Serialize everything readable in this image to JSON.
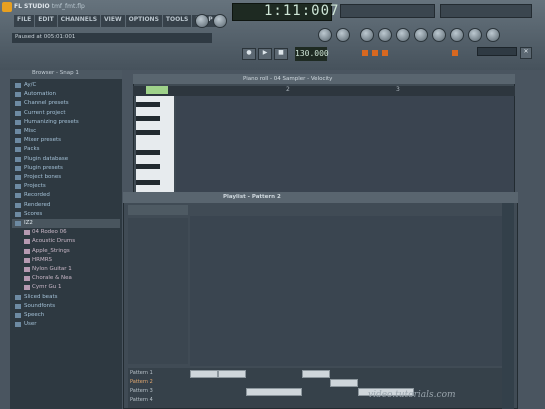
{
  "app": {
    "title": "FL STUDIO",
    "project": "tmf_fmt.flp"
  },
  "menu": [
    "FILE",
    "EDIT",
    "CHANNELS",
    "VIEW",
    "OPTIONS",
    "TOOLS",
    "HELP"
  ],
  "hint_bar": "Paused at 005:01:001",
  "transport": {
    "time": "1:11:007",
    "bpm": "130.000"
  },
  "browser": {
    "title": "Browser - Snap 1",
    "items": [
      {
        "label": "Ay/C",
        "type": "folder"
      },
      {
        "label": "Automation",
        "type": "folder"
      },
      {
        "label": "Channel presets",
        "type": "folder"
      },
      {
        "label": "Current project",
        "type": "folder"
      },
      {
        "label": "Humanizing presets",
        "type": "folder"
      },
      {
        "label": "Misc",
        "type": "folder"
      },
      {
        "label": "Mixer presets",
        "type": "folder"
      },
      {
        "label": "Packs",
        "type": "folder"
      },
      {
        "label": "Plugin database",
        "type": "folder"
      },
      {
        "label": "Plugin presets",
        "type": "folder"
      },
      {
        "label": "Project bones",
        "type": "folder"
      },
      {
        "label": "Projects",
        "type": "folder"
      },
      {
        "label": "Recorded",
        "type": "folder"
      },
      {
        "label": "Rendered",
        "type": "folder"
      },
      {
        "label": "Scores",
        "type": "folder"
      },
      {
        "label": "IZ2",
        "type": "selected"
      },
      {
        "label": "04 Rodeo 06",
        "type": "sub"
      },
      {
        "label": "Acoustic Drums",
        "type": "sub"
      },
      {
        "label": "Apple_Strings",
        "type": "sub"
      },
      {
        "label": "HRMRS",
        "type": "sub"
      },
      {
        "label": "Nylon Guitar 1",
        "type": "sub"
      },
      {
        "label": "Chorale & Nea",
        "type": "sub"
      },
      {
        "label": "Cymr Gu 1",
        "type": "sub"
      },
      {
        "label": "Sliced beats",
        "type": "folder"
      },
      {
        "label": "Soundfonts",
        "type": "folder"
      },
      {
        "label": "Speech",
        "type": "folder"
      },
      {
        "label": "User",
        "type": "folder"
      }
    ]
  },
  "piano_roll": {
    "title": "Piano roll - 04 Sampler - Velocity",
    "bars": [
      "1",
      "2",
      "3"
    ]
  },
  "playlist": {
    "title": "Playlist - Pattern 2",
    "bars": [
      "1",
      "2",
      "3",
      "4",
      "5",
      "6",
      "7",
      "8",
      "9"
    ],
    "patterns": [
      "Pattern 1",
      "Pattern 2",
      "Pattern 3",
      "Pattern 4"
    ]
  },
  "watermark": "video.tutorials.com"
}
